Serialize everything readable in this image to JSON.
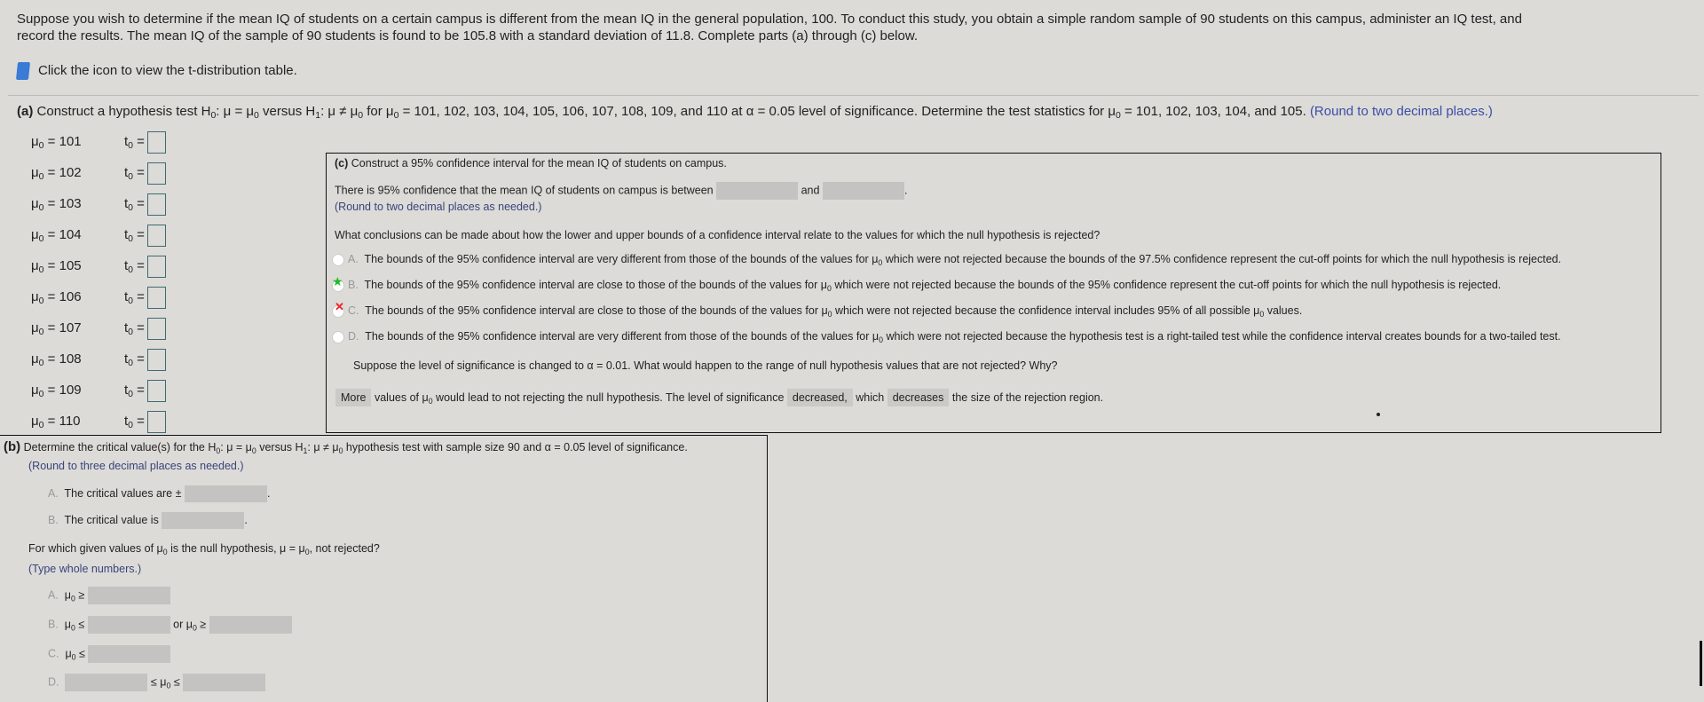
{
  "intro": {
    "line1": "Suppose you wish to determine if the mean IQ of students on a certain campus is different from the mean IQ in the general population, 100. To conduct this study, you obtain a simple random sample of 90 students on this campus, administer an IQ test, and",
    "line2": "record the results. The mean IQ of the sample of 90 students is found to be 105.8 with a standard deviation of 11.8. Complete parts (a) through (c) below.",
    "table_link": "Click the icon to view the t-distribution table.",
    "table_icon": "book-icon"
  },
  "part_a": {
    "label": "(a)",
    "text1": "Construct a hypothesis test H",
    "text2": ": μ = μ",
    "text3": " versus H",
    "text4": ": μ ≠ μ",
    "text5": " for μ",
    "text6": " = 101, 102, 103, 104, 105, 106, 107, 108, 109, and 110 at α = 0.05 level of significance. Determine the test statistics for μ",
    "text7": " = 101, 102, 103, 104, and 105.",
    "hint": "(Round to two decimal places.)",
    "mu_values": [
      "101",
      "102",
      "103",
      "104",
      "105",
      "106",
      "107",
      "108",
      "109",
      "110"
    ]
  },
  "part_c": {
    "title_label": "(c)",
    "title": "Construct a 95% confidence interval for the mean IQ of students on campus.",
    "ci_text": "There is 95% confidence that the mean IQ of students on campus is between",
    "ci_and": "and",
    "ci_hint": "(Round to two decimal places as needed.)",
    "question": "What conclusions can be made about how the lower and upper bounds of a confidence interval relate to the values for which the null hypothesis is rejected?",
    "options": [
      {
        "letter": "A.",
        "pre": "The bounds of the 95% confidence interval are very different from those of the bounds of the values for μ",
        "post": " which were not rejected because the bounds of the 97.5% confidence represent the cut-off points for which the null hypothesis is rejected.",
        "mark": ""
      },
      {
        "letter": "B.",
        "pre": "The bounds of the 95% confidence interval are close to those of the bounds of the values for μ",
        "post": " which were not rejected because the bounds of the 95% confidence represent the cut-off points for which the null hypothesis is rejected.",
        "mark": "correct"
      },
      {
        "letter": "C.",
        "pre": "The bounds of the 95% confidence interval are close to those of the bounds of the values for μ",
        "post": " which were not rejected because the confidence interval includes 95% of all possible μ",
        "post2": " values.",
        "mark": "incorrect"
      },
      {
        "letter": "D.",
        "pre": "The bounds of the 95% confidence interval are very different from those of the bounds of the values for μ",
        "post": " which were not rejected because the hypothesis test is a right-tailed test while the confidence interval creates bounds for a two-tailed test.",
        "mark": ""
      }
    ],
    "sig_question": "Suppose the level of significance is changed to α = 0.01. What would happen to the range of null hypothesis values that are not rejected? Why?",
    "answer": {
      "drop1": "More",
      "t1": "values of μ",
      "t2": " would lead to not rejecting the null hypothesis. The level of significance",
      "drop2": "decreased,",
      "t3": "which",
      "drop3": "decreases",
      "t4": "the size of the rejection region."
    }
  },
  "part_b": {
    "label": "(b)",
    "title1": "Determine the critical value(s) for the H",
    "title2": ": μ = μ",
    "title3": " versus H",
    "title4": ": μ ≠ μ",
    "title5": " hypothesis test with sample size 90 and α = 0.05 level of significance.",
    "hint": "(Round to three decimal places as needed.)",
    "optA": "The critical values are ±",
    "optB": "The critical value is",
    "q2_1": "For which given values of μ",
    "q2_2": " is the null hypothesis, μ = μ",
    "q2_3": ", not rejected?",
    "hint2": "(Type whole numbers.)",
    "or": "or μ"
  },
  "colors": {
    "correct": "#22bb22",
    "incorrect": "#ee2222",
    "hint": "#3b4ea8"
  }
}
